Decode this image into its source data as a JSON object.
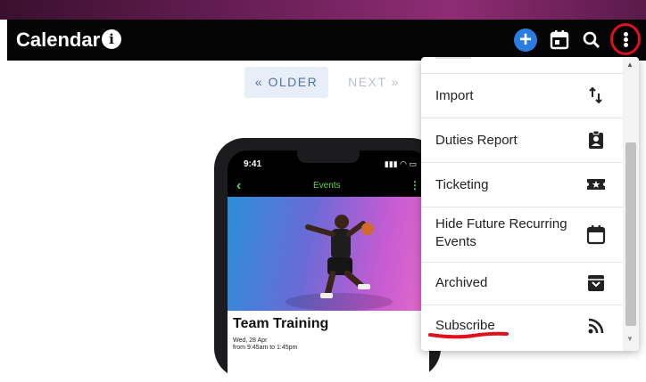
{
  "header": {
    "title": "Calendar",
    "info_icon": "info-icon",
    "add_icon": "plus-icon",
    "calendar_icon": "calendar-icon",
    "search_icon": "search-icon",
    "more_icon": "more-vertical-icon",
    "highlight_color": "#e0101c"
  },
  "pager": {
    "older_label": "« OLDER",
    "next_label": "NEXT »"
  },
  "phone": {
    "status_time": "9:41",
    "app_title": "Events",
    "event_name": "Team Training",
    "event_date": "Wed, 28 Apr",
    "event_time": "from 9:45am to 1:45pm"
  },
  "menu": {
    "items": [
      {
        "label": "Import",
        "icon": "import-export-arrows-icon"
      },
      {
        "label": "Duties Report",
        "icon": "clipboard-person-icon"
      },
      {
        "label": "Ticketing",
        "icon": "ticket-star-icon"
      },
      {
        "label": "Hide Future Recurring Events",
        "icon": "calendar-icon"
      },
      {
        "label": "Archived",
        "icon": "archive-box-icon"
      },
      {
        "label": "Subscribe",
        "icon": "rss-feed-icon"
      }
    ]
  }
}
